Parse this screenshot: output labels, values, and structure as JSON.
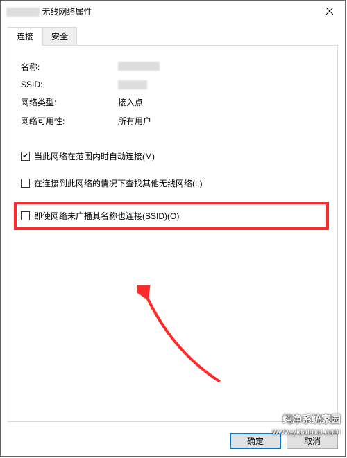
{
  "title_suffix": "无线网络属性",
  "tabs": {
    "connect": "连接",
    "security": "安全"
  },
  "props": {
    "name_label": "名称:",
    "ssid_label": "SSID:",
    "nettype_label": "网络类型:",
    "nettype_value": "接入点",
    "avail_label": "网络可用性:",
    "avail_value": "所有用户"
  },
  "checks": {
    "auto_connect": "当此网络在范围内时自动连接(M)",
    "look_other": "在连接到此网络的情况下查找其他无线网络(L)",
    "connect_hidden": "即使网络未广播其名称也连接(SSID)(O)"
  },
  "buttons": {
    "ok": "确定",
    "cancel": "取消"
  },
  "watermark": {
    "l1": "纯净系统家园",
    "l2": "www.yidaimei.com"
  }
}
